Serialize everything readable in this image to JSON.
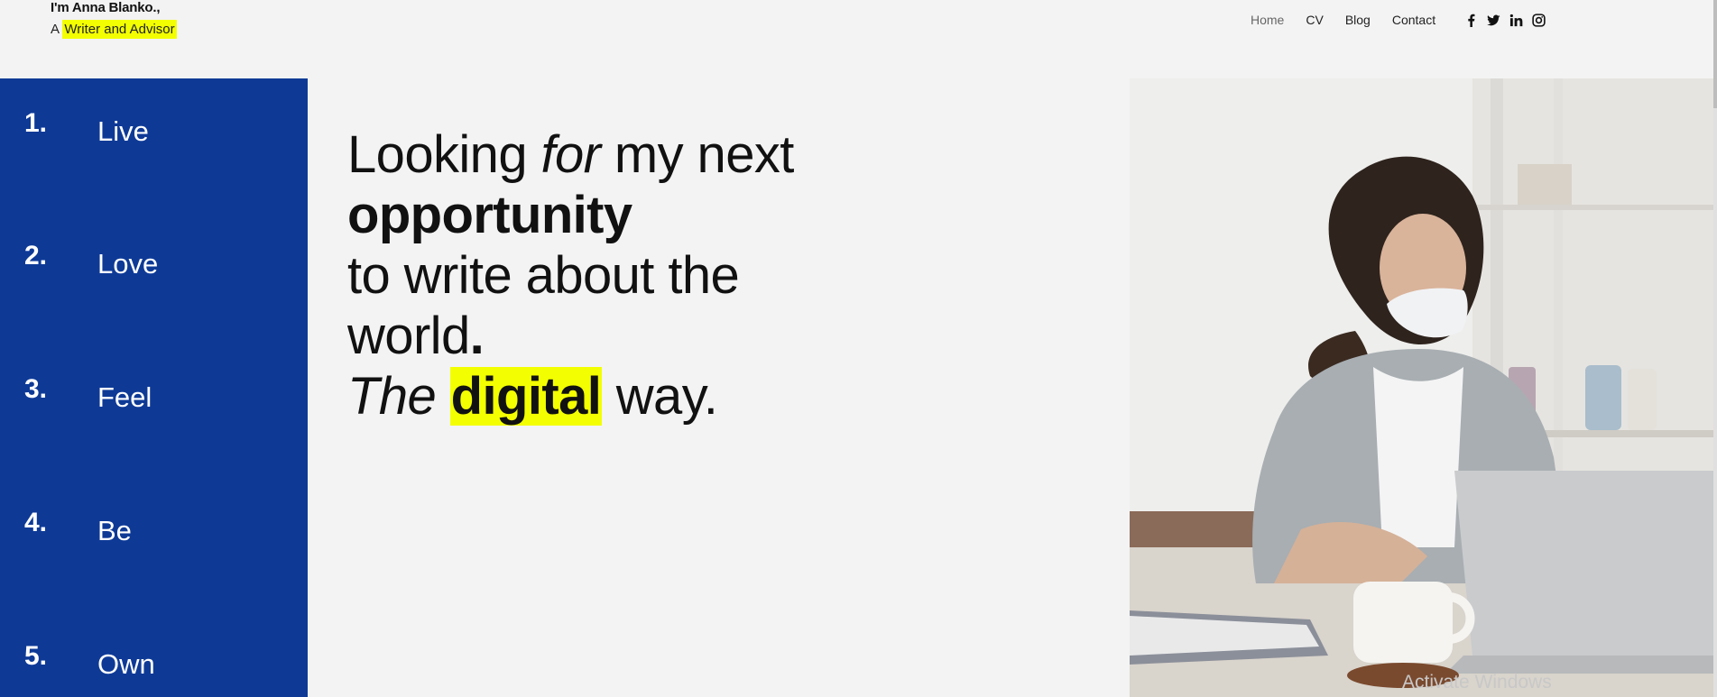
{
  "brand": {
    "name": "I'm Anna Blanko.,",
    "prefix": "A",
    "tagline": "Writer and Advisor"
  },
  "nav": {
    "links": [
      "Home",
      "CV",
      "Blog",
      "Contact"
    ],
    "active": "Home",
    "social_icons": [
      "facebook-icon",
      "twitter-icon",
      "linkedin-icon",
      "instagram-icon"
    ]
  },
  "sidebar": {
    "items": [
      {
        "num": "1.",
        "label": "Live"
      },
      {
        "num": "2.",
        "label": "Love"
      },
      {
        "num": "3.",
        "label": "Feel"
      },
      {
        "num": "4.",
        "label": "Be"
      },
      {
        "num": "5.",
        "label": "Own"
      }
    ]
  },
  "headline": {
    "w1": "Looking",
    "w2": "for",
    "w3": "my next",
    "w4": "opportunity",
    "w5": "to write about the",
    "w6": "world",
    "w7": ".",
    "w8": "The",
    "w9": "digital",
    "w10": "way."
  },
  "watermark": "Activate Windows",
  "colors": {
    "sidebar_bg": "#0e3a96",
    "highlight": "#f3ff00",
    "page_bg": "#f3f3f3"
  }
}
